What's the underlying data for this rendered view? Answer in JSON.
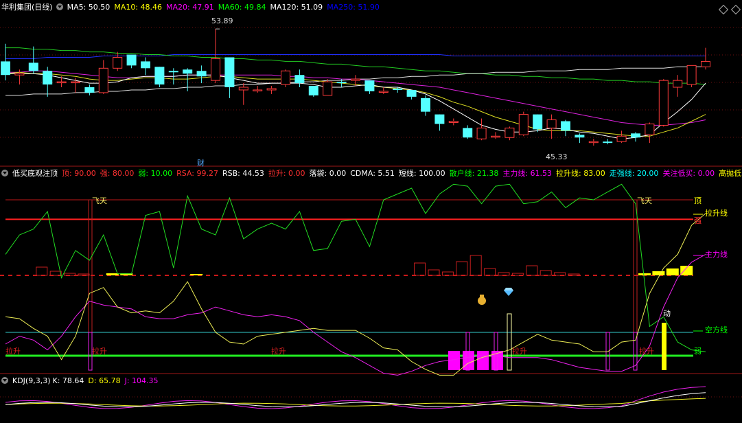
{
  "main_header": {
    "title": "华利集团(日线)",
    "items": [
      {
        "label": "MA5: 50.50",
        "color": "#ffffff"
      },
      {
        "label": "MA10: 48.46",
        "color": "#ffff00"
      },
      {
        "label": "MA20: 47.91",
        "color": "#ff00ff"
      },
      {
        "label": "MA60: 49.84",
        "color": "#00ff00"
      },
      {
        "label": "MA120: 51.09",
        "color": "#ffffff"
      },
      {
        "label": "MA250: 51.90",
        "color": "#0000ff"
      }
    ]
  },
  "main_labels": {
    "high": "53.89",
    "low": "45.33",
    "cai": "财"
  },
  "ind_header": {
    "title": "低买底观注顶",
    "items": [
      {
        "label": "顶: 90.00",
        "color": "#ff3030"
      },
      {
        "label": "强: 80.00",
        "color": "#ff3030"
      },
      {
        "label": "弱: 10.00",
        "color": "#00ff00"
      },
      {
        "label": "RSA: 99.27",
        "color": "#ff3030"
      },
      {
        "label": "RSB: 44.53",
        "color": "#ffffff"
      },
      {
        "label": "拉升: 0.00",
        "color": "#ff3030"
      },
      {
        "label": "落袋: 0.00",
        "color": "#ffffff"
      },
      {
        "label": "CDMA: 5.51",
        "color": "#ffffff"
      },
      {
        "label": "短线: 100.00",
        "color": "#ffffff"
      },
      {
        "label": "散户线: 21.38",
        "color": "#00ff00"
      },
      {
        "label": "主力线: 61.53",
        "color": "#ff00ff"
      },
      {
        "label": "拉升线: 83.00",
        "color": "#ffff00"
      },
      {
        "label": "走强线: 20.00",
        "color": "#00ffff"
      },
      {
        "label": "关注低买: 0.00",
        "color": "#ff00ff"
      },
      {
        "label": "高抛低",
        "color": "#ffff00"
      }
    ]
  },
  "ind_labels": {
    "feitian": "飞天",
    "ding": "顶",
    "qiang": "强",
    "ruo": "弱",
    "lasheng": "拉升",
    "dong": "动",
    "lashengxian": "拉升线",
    "zhulixian": "主力线",
    "kongfangxian": "空方线"
  },
  "kdj_header": {
    "title": "KDJ(9,3,3)",
    "items": [
      {
        "label": "K: 78.64",
        "color": "#ffffff"
      },
      {
        "label": "D: 65.78",
        "color": "#ffff00"
      },
      {
        "label": "J: 104.35",
        "color": "#ff00ff"
      }
    ]
  },
  "chart_data": {
    "type": "candlestick",
    "title": "华利集团(日线)",
    "annotations": {
      "max": 53.89,
      "min": 45.33
    },
    "ind_levels": {
      "顶": 90,
      "强": 80,
      "弱": 10
    },
    "candles": [
      {
        "o": 51.5,
        "c": 50.5,
        "h": 52.8,
        "l": 50.1
      },
      {
        "o": 50.5,
        "c": 50.6,
        "h": 50.9,
        "l": 49.8
      },
      {
        "o": 51.4,
        "c": 50.8,
        "h": 52.6,
        "l": 50.6
      },
      {
        "o": 50.8,
        "c": 49.8,
        "h": 51.1,
        "l": 48.9
      },
      {
        "o": 50.0,
        "c": 50.0,
        "h": 50.4,
        "l": 49.6
      },
      {
        "o": 50.0,
        "c": 50.0,
        "h": 50.3,
        "l": 49.2
      },
      {
        "o": 49.6,
        "c": 49.2,
        "h": 49.8,
        "l": 49.0
      },
      {
        "o": 49.2,
        "c": 51.0,
        "h": 51.6,
        "l": 49.1
      },
      {
        "o": 51.0,
        "c": 51.8,
        "h": 52.2,
        "l": 50.8
      },
      {
        "o": 52.0,
        "c": 51.2,
        "h": 52.0,
        "l": 51.0
      },
      {
        "o": 51.5,
        "c": 51.0,
        "h": 51.8,
        "l": 50.5
      },
      {
        "o": 51.1,
        "c": 49.8,
        "h": 51.1,
        "l": 49.6
      },
      {
        "o": 50.8,
        "c": 50.7,
        "h": 51.0,
        "l": 49.8
      },
      {
        "o": 50.9,
        "c": 50.6,
        "h": 51.0,
        "l": 49.3
      },
      {
        "o": 50.8,
        "c": 50.4,
        "h": 51.2,
        "l": 49.9
      },
      {
        "o": 50.1,
        "c": 51.7,
        "h": 53.89,
        "l": 49.9
      },
      {
        "o": 51.8,
        "c": 49.6,
        "h": 51.8,
        "l": 48.8
      },
      {
        "o": 49.4,
        "c": 49.6,
        "h": 49.9,
        "l": 48.3
      },
      {
        "o": 49.4,
        "c": 49.4,
        "h": 49.7,
        "l": 49.2
      },
      {
        "o": 49.4,
        "c": 49.5,
        "h": 49.7,
        "l": 49.1
      },
      {
        "o": 49.8,
        "c": 50.8,
        "h": 50.9,
        "l": 49.6
      },
      {
        "o": 50.5,
        "c": 49.9,
        "h": 50.9,
        "l": 49.6
      },
      {
        "o": 49.7,
        "c": 49.0,
        "h": 49.7,
        "l": 48.9
      },
      {
        "o": 49.0,
        "c": 50.0,
        "h": 50.2,
        "l": 49.0
      },
      {
        "o": 50.0,
        "c": 49.9,
        "h": 50.2,
        "l": 49.6
      },
      {
        "o": 50.1,
        "c": 50.2,
        "h": 50.5,
        "l": 49.7
      },
      {
        "o": 50.1,
        "c": 49.3,
        "h": 50.1,
        "l": 49.1
      },
      {
        "o": 49.3,
        "c": 49.3,
        "h": 49.6,
        "l": 49.1
      },
      {
        "o": 49.5,
        "c": 49.4,
        "h": 49.6,
        "l": 49.2
      },
      {
        "o": 49.4,
        "c": 48.9,
        "h": 49.4,
        "l": 48.7
      },
      {
        "o": 48.8,
        "c": 47.8,
        "h": 49.0,
        "l": 47.5
      },
      {
        "o": 47.6,
        "c": 46.9,
        "h": 47.6,
        "l": 46.4
      },
      {
        "o": 47.0,
        "c": 47.1,
        "h": 47.3,
        "l": 46.8
      },
      {
        "o": 46.6,
        "c": 45.9,
        "h": 46.8,
        "l": 45.8
      },
      {
        "o": 45.8,
        "c": 46.6,
        "h": 47.3,
        "l": 45.7
      },
      {
        "o": 46.0,
        "c": 46.0,
        "h": 46.3,
        "l": 45.8
      },
      {
        "o": 45.9,
        "c": 46.6,
        "h": 46.7,
        "l": 45.7
      },
      {
        "o": 46.1,
        "c": 47.6,
        "h": 47.8,
        "l": 46.0
      },
      {
        "o": 47.6,
        "c": 46.5,
        "h": 47.6,
        "l": 46.3
      },
      {
        "o": 46.6,
        "c": 47.2,
        "h": 47.6,
        "l": 45.8
      },
      {
        "o": 47.1,
        "c": 46.4,
        "h": 47.2,
        "l": 46.0
      },
      {
        "o": 46.1,
        "c": 45.9,
        "h": 46.2,
        "l": 45.5
      },
      {
        "o": 45.6,
        "c": 45.6,
        "h": 45.8,
        "l": 45.3
      },
      {
        "o": 45.6,
        "c": 45.5,
        "h": 45.8,
        "l": 45.4
      },
      {
        "o": 45.6,
        "c": 46.0,
        "h": 46.4,
        "l": 45.5
      },
      {
        "o": 46.2,
        "c": 45.9,
        "h": 46.3,
        "l": 45.6
      },
      {
        "o": 46.1,
        "c": 46.9,
        "h": 47.0,
        "l": 45.5
      },
      {
        "o": 46.8,
        "c": 50.1,
        "h": 50.2,
        "l": 46.7
      },
      {
        "o": 49.6,
        "c": 50.1,
        "h": 50.5,
        "l": 48.9
      },
      {
        "o": 49.8,
        "c": 51.2,
        "h": 51.2,
        "l": 49.6
      },
      {
        "o": 51.1,
        "c": 51.5,
        "h": 52.5,
        "l": 50.9
      }
    ],
    "ma5": [
      50.6,
      50.6,
      50.6,
      50.5,
      50.3,
      50.1,
      49.9,
      49.9,
      50.0,
      50.3,
      50.4,
      50.4,
      50.4,
      50.5,
      50.5,
      50.5,
      50.3,
      50.1,
      49.9,
      49.9,
      49.9,
      49.9,
      49.8,
      49.6,
      49.6,
      49.7,
      49.8,
      49.6,
      49.6,
      49.4,
      49.1,
      48.6,
      48.0,
      47.4,
      46.8,
      46.5,
      46.3,
      46.3,
      46.4,
      46.6,
      46.5,
      46.3,
      46.2,
      46.0,
      45.8,
      45.9,
      46.1,
      47.0,
      47.8,
      48.7,
      49.9
    ],
    "ma10": [
      50.6,
      50.7,
      50.6,
      50.6,
      50.5,
      50.4,
      50.2,
      50.1,
      50.1,
      50.2,
      50.3,
      50.3,
      50.2,
      50.2,
      50.3,
      50.4,
      50.4,
      50.3,
      50.2,
      50.2,
      50.2,
      50.2,
      50.1,
      50.0,
      49.9,
      49.8,
      49.7,
      49.6,
      49.5,
      49.4,
      49.2,
      48.9,
      48.5,
      48.2,
      47.8,
      47.4,
      47.1,
      46.8,
      46.5,
      46.4,
      46.4,
      46.4,
      46.3,
      46.2,
      46.1,
      46.0,
      46.0,
      46.3,
      46.6,
      47.1,
      47.6
    ],
    "ma20": [
      50.7,
      50.7,
      50.8,
      50.8,
      50.7,
      50.6,
      50.5,
      50.4,
      50.3,
      50.3,
      50.4,
      50.4,
      50.4,
      50.5,
      50.5,
      50.5,
      50.5,
      50.5,
      50.5,
      50.5,
      50.4,
      50.4,
      50.3,
      50.3,
      50.2,
      50.2,
      50.1,
      50.0,
      49.9,
      49.8,
      49.7,
      49.6,
      49.4,
      49.2,
      49.0,
      48.8,
      48.6,
      48.4,
      48.2,
      48.0,
      47.8,
      47.6,
      47.4,
      47.2,
      47.0,
      46.9,
      46.8,
      46.8,
      46.9,
      47.0,
      47.2
    ],
    "ma60": [
      52.5,
      52.5,
      52.4,
      52.4,
      52.3,
      52.3,
      52.2,
      52.2,
      52.1,
      52.1,
      52.0,
      52.0,
      51.9,
      51.9,
      51.8,
      51.8,
      51.7,
      51.7,
      51.6,
      51.6,
      51.5,
      51.5,
      51.4,
      51.3,
      51.3,
      51.2,
      51.1,
      51.1,
      51.0,
      50.9,
      50.8,
      50.8,
      50.7,
      50.6,
      50.6,
      50.5,
      50.5,
      50.4,
      50.4,
      50.3,
      50.3,
      50.2,
      50.2,
      50.1,
      50.1,
      50.0,
      50.0,
      49.9,
      49.9,
      49.9,
      49.8
    ],
    "ma120": [
      49.0,
      49.0,
      49.1,
      49.1,
      49.1,
      49.2,
      49.2,
      49.3,
      49.3,
      49.4,
      49.4,
      49.5,
      49.5,
      49.6,
      49.6,
      49.7,
      49.7,
      49.8,
      49.8,
      49.9,
      49.9,
      50.0,
      50.0,
      50.1,
      50.1,
      50.2,
      50.2,
      50.3,
      50.3,
      50.4,
      50.4,
      50.5,
      50.5,
      50.6,
      50.6,
      50.7,
      50.7,
      50.7,
      50.8,
      50.8,
      50.8,
      50.9,
      50.9,
      50.9,
      51.0,
      51.0,
      51.0,
      51.0,
      51.1,
      51.1,
      51.1
    ],
    "ma250": [
      51.7,
      51.7,
      51.7,
      51.8,
      51.8,
      51.8,
      51.8,
      51.9,
      51.9,
      51.9,
      51.9,
      51.9,
      52.0,
      52.0,
      52.0,
      52.0,
      52.0,
      52.0,
      52.0,
      52.0,
      52.0,
      52.0,
      52.0,
      52.0,
      52.0,
      52.0,
      52.0,
      52.0,
      52.0,
      52.0,
      52.0,
      52.0,
      51.9,
      51.9,
      51.9,
      51.9,
      51.9,
      51.9,
      51.9,
      51.9,
      51.9,
      51.9,
      51.9,
      51.9,
      51.9,
      51.9,
      51.9,
      51.9,
      51.9,
      51.9,
      51.9
    ],
    "ind_green": [
      62,
      72,
      75,
      84,
      50,
      64,
      59,
      72,
      52,
      52,
      82,
      84,
      55,
      92,
      75,
      72,
      91,
      70,
      75,
      78,
      75,
      84,
      64,
      65,
      79,
      80,
      66,
      90,
      93,
      96,
      83,
      93,
      98,
      97,
      88,
      97,
      98,
      88,
      89,
      94,
      86,
      91,
      90,
      94,
      98,
      88,
      25,
      30,
      17,
      13,
      12
    ],
    "ind_yellow": [
      30,
      29,
      24,
      20,
      8,
      20,
      42,
      45,
      35,
      32,
      33,
      32,
      38,
      48,
      34,
      22,
      17,
      16,
      20,
      21,
      22,
      23,
      24,
      23,
      23,
      23,
      19,
      14,
      13,
      7,
      3,
      0,
      0,
      6,
      9,
      11,
      13,
      17,
      21,
      18,
      17,
      16,
      12,
      12,
      17,
      18,
      42,
      55,
      62,
      77,
      83
    ],
    "ind_magenta": [
      16,
      20,
      18,
      13,
      20,
      30,
      38,
      36,
      35,
      34,
      30,
      29,
      29,
      31,
      32,
      35,
      33,
      31,
      30,
      31,
      30,
      28,
      22,
      17,
      12,
      9,
      5,
      1,
      0,
      2,
      5,
      7,
      8,
      9,
      10,
      10,
      9,
      9,
      9,
      8,
      6,
      4,
      3,
      2,
      2,
      5,
      15,
      35,
      50,
      58,
      62
    ]
  }
}
